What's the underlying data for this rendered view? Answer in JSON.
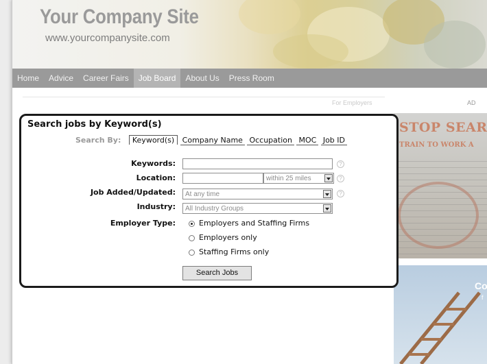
{
  "site": {
    "title": "Your Company Site",
    "url": "www.yourcompanysite.com"
  },
  "nav": {
    "items": [
      "Home",
      "Advice",
      "Career Fairs",
      "Job Board",
      "About Us",
      "Press Room"
    ],
    "active": "Job Board"
  },
  "subnav": {
    "for_employers": "For Employers",
    "ad_label": "AD"
  },
  "search": {
    "title": "Search jobs by Keyword(s)",
    "search_by_label": "Search By:",
    "tabs": [
      "Keyword(s)",
      "Company Name",
      "Occupation",
      "MOC",
      "Job ID"
    ],
    "active_tab": "Keyword(s)",
    "fields": {
      "keywords_label": "Keywords:",
      "keywords_value": "",
      "location_label": "Location:",
      "location_value": "",
      "radius_value": "within 25 miles",
      "added_label": "Job Added/Updated:",
      "added_value": "At any time",
      "industry_label": "Industry:",
      "industry_value": "All Industry Groups",
      "employer_type_label": "Employer Type:"
    },
    "employer_options": [
      "Employers and Staffing Firms",
      "Employers only",
      "Staffing Firms only"
    ],
    "employer_selected": "Employers and Staffing Firms",
    "help_glyph": "?",
    "submit_label": "Search Jobs"
  },
  "ads": {
    "ad1_headline": "STOP SEAR",
    "ad1_sub": "TRAIN TO WORK A",
    "ad2_text": "Co",
    "ad2_text2": "f"
  },
  "colors": {
    "nav_bg": "#9a9a9a",
    "nav_active": "#b4b4b4",
    "panel_border": "#1a1a1a",
    "ad_accent": "#c9856a"
  }
}
